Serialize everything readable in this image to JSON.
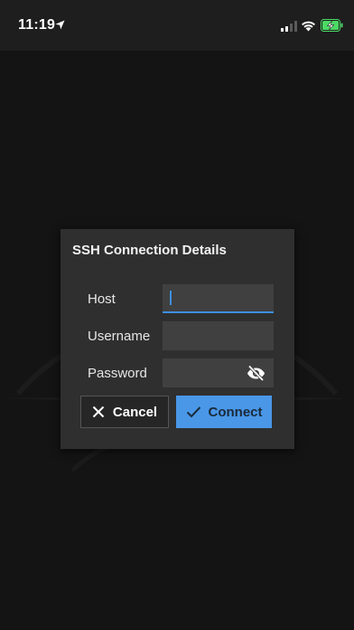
{
  "status_bar": {
    "time": "11:19",
    "location_icon": "location-arrow-icon",
    "signal_icon": "cellular-signal-icon",
    "wifi_icon": "wifi-icon",
    "battery_icon": "battery-charging-icon",
    "battery_color": "#4cd964"
  },
  "dialog": {
    "title": "SSH Connection Details",
    "fields": {
      "host": {
        "label": "Host",
        "value": "",
        "placeholder": ""
      },
      "username": {
        "label": "Username",
        "value": "",
        "placeholder": ""
      },
      "password": {
        "label": "Password",
        "value": "",
        "placeholder": "",
        "toggle_icon": "eye-off-icon"
      }
    },
    "buttons": {
      "cancel": {
        "label": "Cancel",
        "icon": "close-icon"
      },
      "connect": {
        "label": "Connect",
        "icon": "checkmark-icon"
      }
    }
  },
  "colors": {
    "background": "#141414",
    "dialog": "#2f2f2f",
    "input": "#404040",
    "accent": "#4a97e8"
  }
}
